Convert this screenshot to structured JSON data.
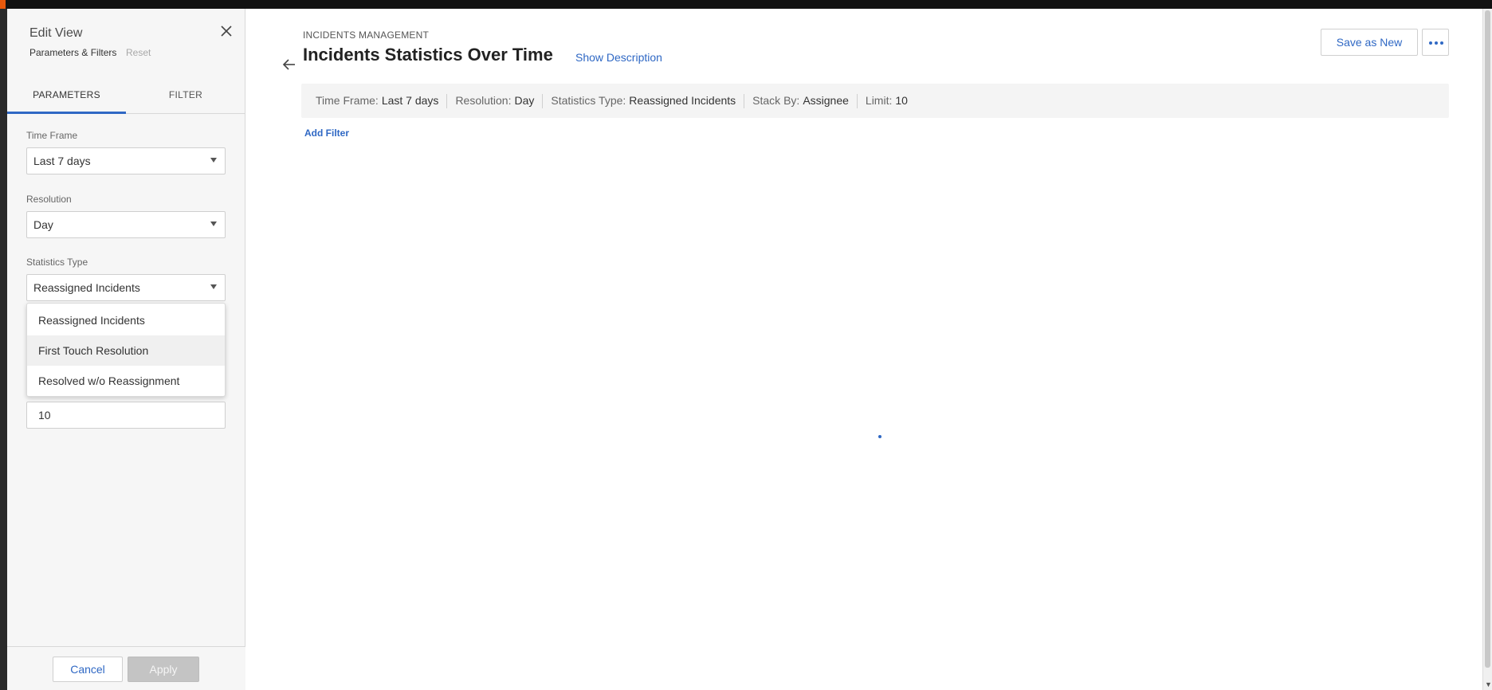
{
  "colors": {
    "accent": "#2f68c4",
    "brand_orange": "#e8590c",
    "panel_bg": "#f6f6f6"
  },
  "panel": {
    "title": "Edit View",
    "subtitle": "Parameters & Filters",
    "reset_label": "Reset",
    "tabs": [
      {
        "label": "PARAMETERS",
        "active": true
      },
      {
        "label": "FILTER",
        "active": false
      }
    ],
    "fields": {
      "time_frame": {
        "label": "Time Frame",
        "value": "Last 7 days"
      },
      "resolution": {
        "label": "Resolution",
        "value": "Day"
      },
      "statistics_type": {
        "label": "Statistics Type",
        "value": "Reassigned Incidents"
      },
      "limit": {
        "value": "10"
      }
    },
    "dropdown_options": [
      "Reassigned Incidents",
      "First Touch Resolution",
      "Resolved w/o Reassignment"
    ],
    "cancel_label": "Cancel",
    "apply_label": "Apply"
  },
  "main": {
    "breadcrumb": "INCIDENTS MANAGEMENT",
    "title": "Incidents Statistics Over Time",
    "show_description_label": "Show Description",
    "save_as_new_label": "Save as New",
    "summary": [
      {
        "key": "Time Frame:",
        "value": "Last 7 days"
      },
      {
        "key": "Resolution:",
        "value": "Day"
      },
      {
        "key": "Statistics Type:",
        "value": "Reassigned Incidents"
      },
      {
        "key": "Stack By:",
        "value": "Assignee"
      },
      {
        "key": "Limit:",
        "value": "10"
      }
    ],
    "add_filter_label": "Add Filter"
  },
  "icons": [
    "close-icon",
    "back-arrow-icon",
    "more-options-icon",
    "chevron-down-icon",
    "loading-indicator"
  ]
}
